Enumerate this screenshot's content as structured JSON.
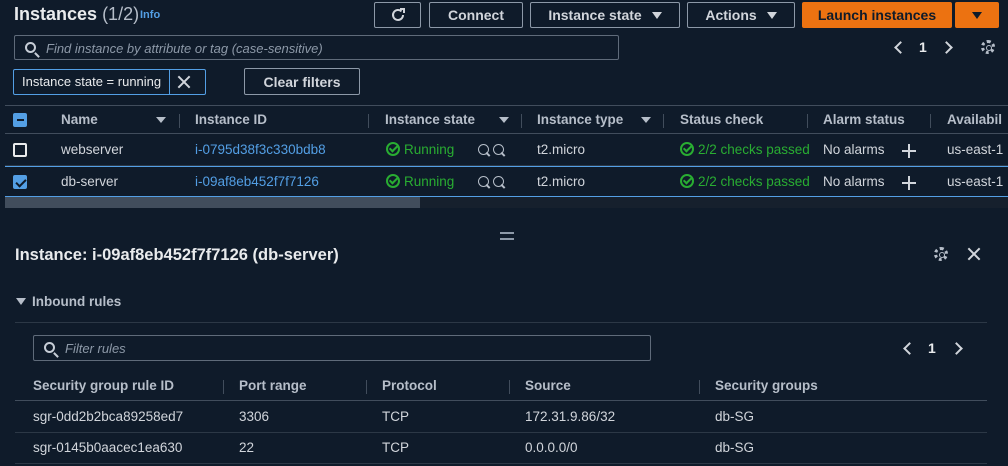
{
  "header": {
    "title": "Instances",
    "count": "(1/2)",
    "info": "Info",
    "connect": "Connect",
    "instance_state": "Instance state",
    "actions": "Actions",
    "launch": "Launch instances"
  },
  "search": {
    "placeholder": "Find instance by attribute or tag (case-sensitive)"
  },
  "pagination": {
    "page": "1"
  },
  "filter": {
    "token": "Instance state = running",
    "clear": "Clear filters"
  },
  "columns": [
    "Name",
    "Instance ID",
    "Instance state",
    "Instance type",
    "Status check",
    "Alarm status",
    "Availabil"
  ],
  "instances": [
    {
      "name": "webserver",
      "id": "i-0795d38f3c330bdb8",
      "state": "Running",
      "type": "t2.micro",
      "status": "2/2 checks passed",
      "alarm": "No alarms",
      "az": "us-east-1",
      "selected": false
    },
    {
      "name": "db-server",
      "id": "i-09af8eb452f7f7126",
      "state": "Running",
      "type": "t2.micro",
      "status": "2/2 checks passed",
      "alarm": "No alarms",
      "az": "us-east-1",
      "selected": true
    }
  ],
  "panel": {
    "title": "Instance: i-09af8eb452f7f7126 (db-server)",
    "section": "Inbound rules",
    "filter_placeholder": "Filter rules",
    "page": "1",
    "columns": [
      "Security group rule ID",
      "Port range",
      "Protocol",
      "Source",
      "Security groups"
    ],
    "rules": [
      {
        "id": "sgr-0dd2b2bca89258ed7",
        "port": "3306",
        "protocol": "TCP",
        "source": "172.31.9.86/32",
        "group": "db-SG"
      },
      {
        "id": "sgr-0145b0aacec1ea630",
        "port": "22",
        "protocol": "TCP",
        "source": "0.0.0.0/0",
        "group": "db-SG"
      }
    ]
  },
  "colors": {
    "background": "#0f1b2a",
    "accent": "#539fe5",
    "primary": "#ec7211",
    "success": "#29ad32"
  }
}
